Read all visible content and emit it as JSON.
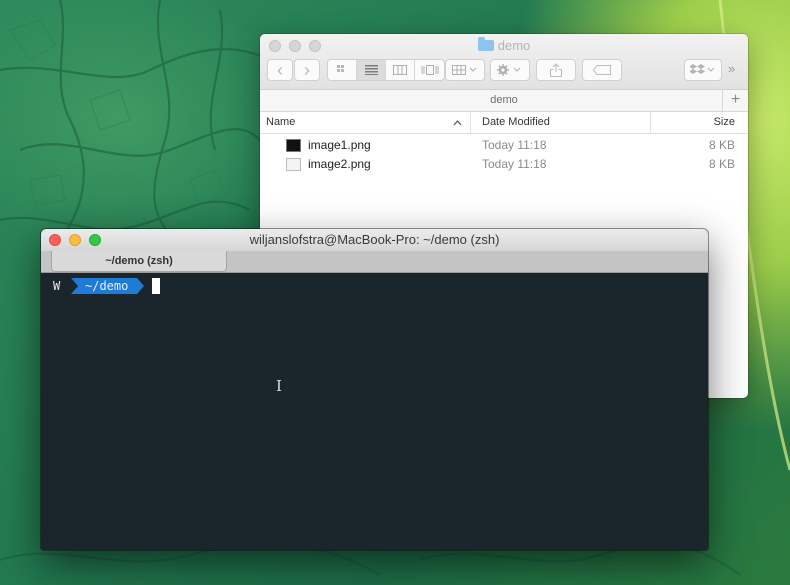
{
  "finder": {
    "title": "demo",
    "path": "demo",
    "columns": {
      "name": "Name",
      "date": "Date Modified",
      "size": "Size"
    },
    "files": [
      {
        "name": "image1.png",
        "date": "Today 11:18",
        "size": "8 KB",
        "thumb": "dark"
      },
      {
        "name": "image2.png",
        "date": "Today 11:18",
        "size": "8 KB",
        "thumb": "light"
      }
    ],
    "toolbar": {
      "back_icon": "‹",
      "forward_icon": "›",
      "overflow_icon": "»",
      "path_add_icon": "+"
    }
  },
  "terminal": {
    "title": "wiljanslofstra@MacBook-Pro: ~/demo (zsh)",
    "tab_label": "~/demo (zsh)",
    "prompt_user": "W",
    "prompt_dir": "~/demo"
  },
  "colors": {
    "prompt_segment": "#1f7bd6",
    "terminal_bg": "#1b252c",
    "folder_icon": "#8ec4ef"
  }
}
